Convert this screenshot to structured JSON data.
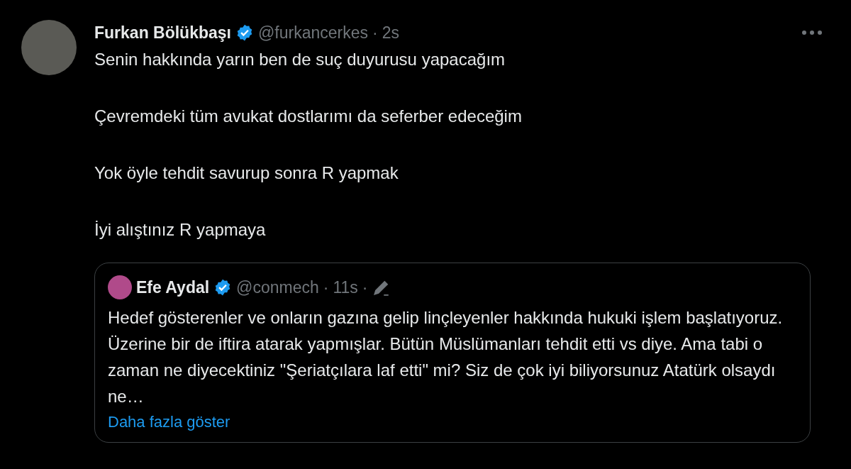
{
  "tweet": {
    "author": "Furkan Bölükbaşı",
    "verified": true,
    "handle": "@furkancerkes",
    "separator": "·",
    "time": "2s",
    "paragraphs": [
      "Senin hakkında yarın ben de suç duyurusu yapacağım",
      "Çevremdeki tüm avukat dostlarımı da seferber edeceğim",
      "Yok öyle tehdit savurup sonra R yapmak",
      "İyi alıştınız R yapmaya"
    ],
    "quote": {
      "author": "Efe Aydal",
      "verified": true,
      "handle": "@conmech",
      "separator": "·",
      "time": "11s",
      "separator_2": "·",
      "edited": true,
      "text": "Hedef gösterenler ve onların gazına gelip linçleyenler hakkında hukuki işlem başlatıyoruz. Üzerine bir de iftira atarak yapmışlar. Bütün Müslümanları tehdit etti vs diye. Ama tabi o zaman ne diyecektiniz \"Şeriatçılara laf etti\" mi? Siz de çok iyi biliyorsunuz Atatürk olsaydı ne…",
      "show_more": "Daha fazla göster"
    }
  }
}
